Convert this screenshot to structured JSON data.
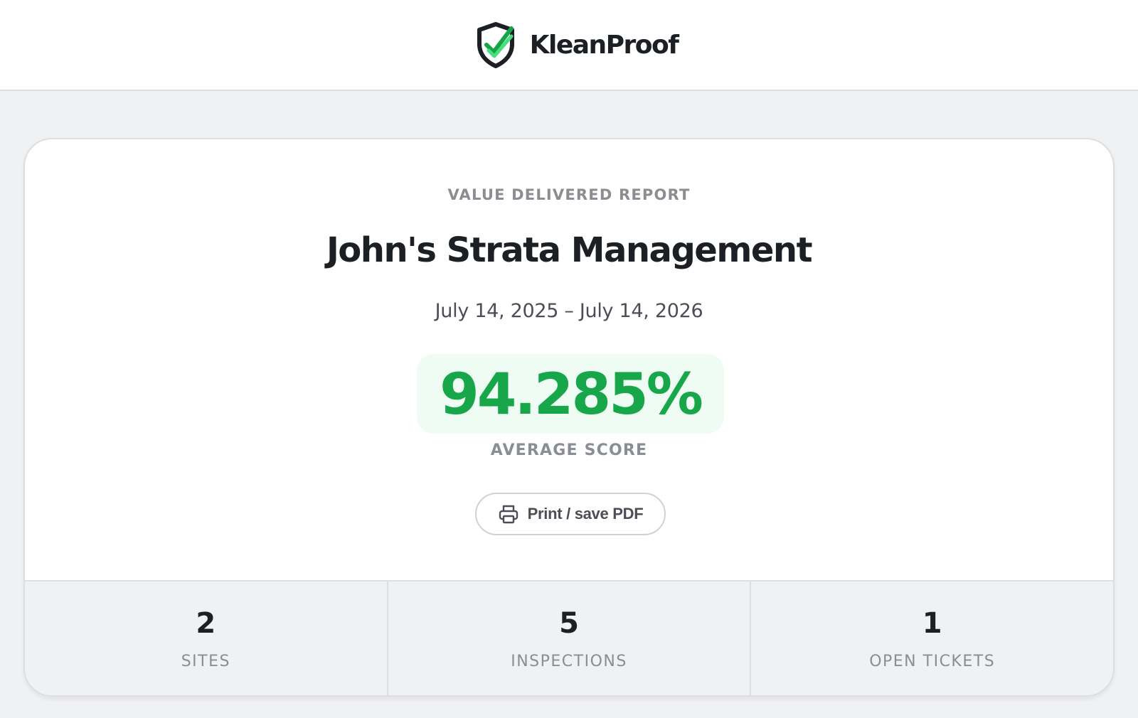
{
  "brand": {
    "name": "KleanProof",
    "logo_icon": "shield-check-icon",
    "colors": {
      "shield": "#1c1f23",
      "check_dark": "#16a34a",
      "check_light": "#4ade80"
    }
  },
  "report": {
    "eyebrow": "VALUE DELIVERED REPORT",
    "organization": "John's Strata Management",
    "date_range": "July 14, 2025 – July 14, 2026",
    "average_score": "94.285%",
    "average_score_label": "AVERAGE SCORE",
    "score_color": "#18a64b"
  },
  "actions": {
    "print_label": "Print / save PDF",
    "print_icon": "printer-icon"
  },
  "stats": [
    {
      "value": "2",
      "label": "SITES"
    },
    {
      "value": "5",
      "label": "INSPECTIONS"
    },
    {
      "value": "1",
      "label": "OPEN TICKETS"
    }
  ]
}
